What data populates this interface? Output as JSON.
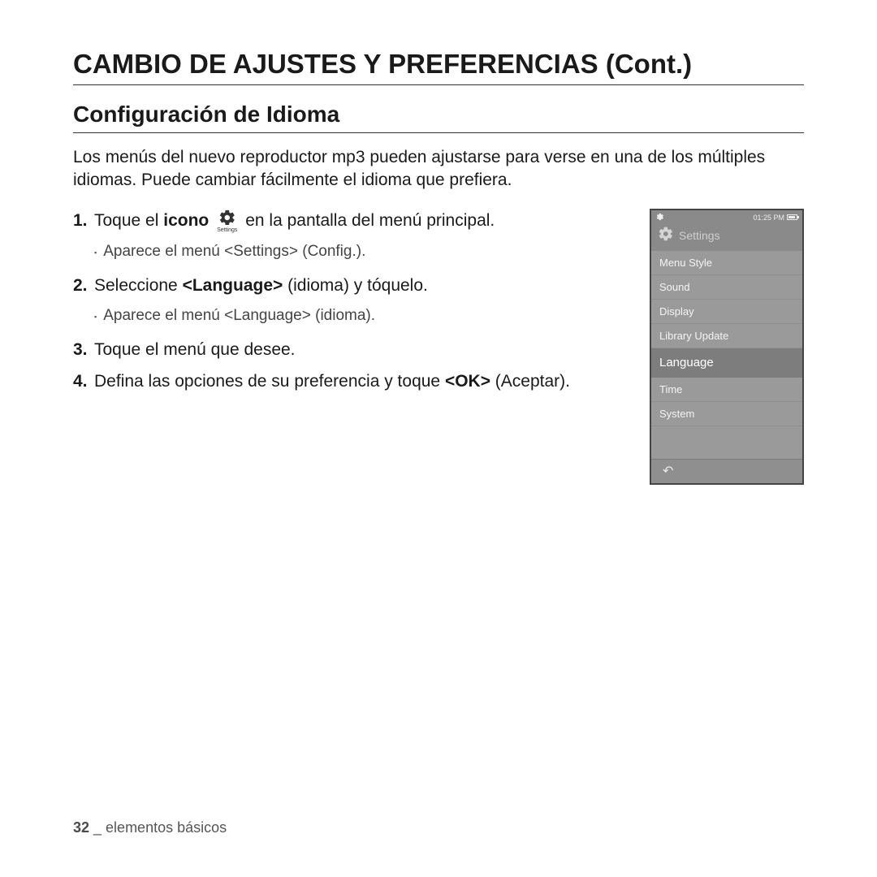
{
  "heading": "CAMBIO DE AJUSTES Y PREFERENCIAS (Cont.)",
  "section": "Conﬁguración de Idioma",
  "intro": "Los menús del nuevo reproductor mp3 pueden ajustarse para verse en una de los múltiples idiomas. Puede cambiar fácilmente el idioma que preﬁera.",
  "steps": {
    "s1": {
      "num": "1.",
      "a": "Toque el ",
      "b_bold": "icono",
      "c": " en la pantalla del menú principal.",
      "icon_label": "Settings",
      "sub": "Aparece el menú <Settings> (Conﬁg.)."
    },
    "s2": {
      "num": "2.",
      "a": "Seleccione ",
      "b_bold": "<Language>",
      "c": " (idioma) y tóquelo.",
      "sub": "Aparece el menú <Language> (idioma)."
    },
    "s3": {
      "num": "3.",
      "text": "Toque el menú que desee."
    },
    "s4": {
      "num": "4.",
      "a": "Deﬁna las opciones de su preferencia y toque ",
      "b_bold": "<OK>",
      "c": " (Aceptar)."
    }
  },
  "device": {
    "time": "01:25 PM",
    "title": "Settings",
    "items": [
      {
        "label": "Menu Style",
        "selected": false
      },
      {
        "label": "Sound",
        "selected": false
      },
      {
        "label": "Display",
        "selected": false
      },
      {
        "label": "Library Update",
        "selected": false
      },
      {
        "label": "Language",
        "selected": true
      },
      {
        "label": "Time",
        "selected": false
      },
      {
        "label": "System",
        "selected": false
      }
    ]
  },
  "footer": {
    "page": "32",
    "sep": " _ ",
    "section": "elementos básicos"
  }
}
